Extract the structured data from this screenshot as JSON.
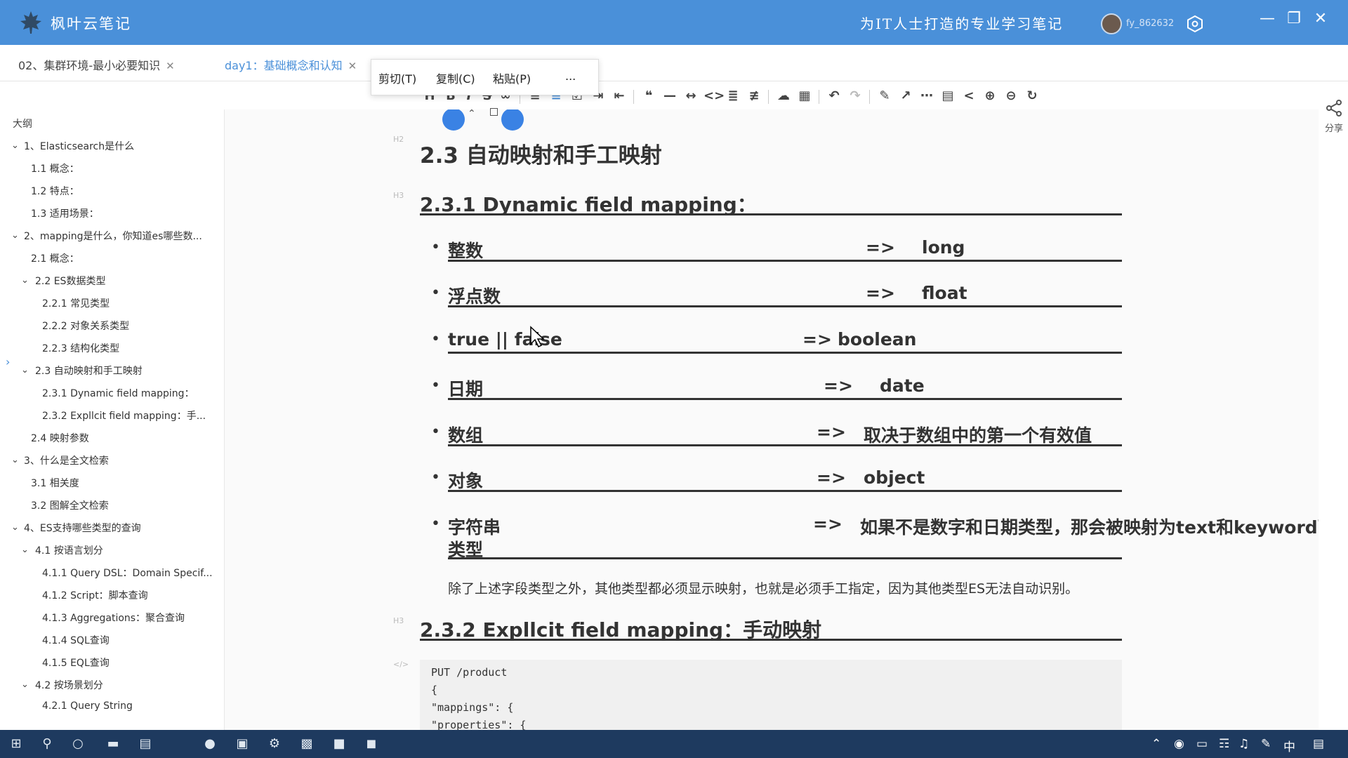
{
  "app": {
    "name": "枫叶云笔记",
    "slogan": "为IT人士打造的专业学习笔记",
    "username": "fy_862632"
  },
  "tabs": [
    {
      "label": "02、集群环境-最小必要知识"
    },
    {
      "label": "day1：基础概念和认知"
    }
  ],
  "context_menu": {
    "cut": "剪切(T)",
    "copy": "复制(C)",
    "paste": "粘贴(P)",
    "more": "..."
  },
  "outline": {
    "title": "大纲",
    "items": [
      "1、Elasticsearch是什么",
      "1.1 概念：",
      "1.2 特点：",
      "1.3 适用场景：",
      "2、mapping是什么，你知道es哪些数...",
      "2.1 概念：",
      "2.2 ES数据类型",
      "2.2.1 常见类型",
      "2.2.2 对象关系类型",
      "2.2.3 结构化类型",
      "2.3 自动映射和手工映射",
      "2.3.1 Dynamic field mapping：",
      "2.3.2 Expllcit field mapping：手...",
      "2.4 映射参数",
      "3、什么是全文检索",
      "3.1 相关度",
      "3.2 图解全文检索",
      "4、ES支持哪些类型的查询",
      "4.1 按语言划分",
      "4.1.1 Query DSL：Domain Specif...",
      "4.1.2 Script：脚本查询",
      "4.1.3 Aggregations：聚合查询",
      "4.1.4 SQL查询",
      "4.1.5 EQL查询",
      "4.2 按场景划分",
      "4.2.1 Query String"
    ]
  },
  "doc": {
    "tag_h2": "H2",
    "tag_h3": "H3",
    "tag_code": "</>",
    "h2": "2.3 自动映射和手工映射",
    "h3_1": "2.3.1 Dynamic field mapping：",
    "h3_2": "2.3.2 Expllcit field mapping：手动映射",
    "list": [
      {
        "key": "整数",
        "arrow": "=>",
        "val": "long"
      },
      {
        "key": "浮点数",
        "arrow": "=>",
        "val": "float"
      },
      {
        "key": "true || false",
        "arrow": "=>",
        "val": "boolean"
      },
      {
        "key": "日期",
        "arrow": "=>",
        "val": "date"
      },
      {
        "key": "数组",
        "arrow": "=>",
        "val": "取决于数组中的第一个有效值"
      },
      {
        "key": "对象",
        "arrow": "=>",
        "val": "object"
      },
      {
        "key": "字符串",
        "arrow": "=>",
        "val": "如果不是数字和日期类型，那会被映射为text和keyword两个",
        "cont": "类型"
      }
    ],
    "para": "除了上述字段类型之外，其他类型都必须显示映射，也就是必须手工指定，因为其他类型ES无法自动识别。",
    "code_lines": [
      "PUT /product",
      "{",
      "    \"mappings\": {",
      "    \"properties\": {"
    ]
  },
  "share_label": "分享",
  "tray": {
    "ime": "中"
  },
  "colors": {
    "accent": "#4a90d9",
    "taskbar": "#1e3a5f"
  }
}
